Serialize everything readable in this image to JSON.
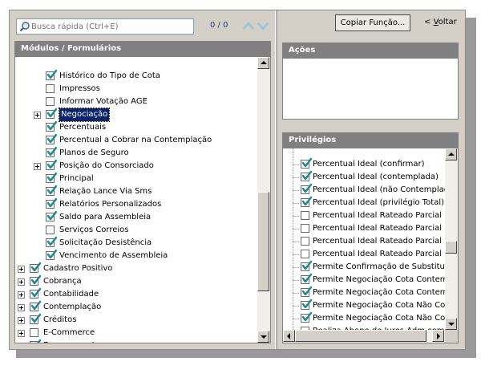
{
  "search": {
    "placeholder": "Busca rápida (Ctrl+E)",
    "count": "0 / 0"
  },
  "toolbar": {
    "copy_label": "Copiar Função...",
    "back_prefix": "< ",
    "back_underlined": "V",
    "back_rest": "oltar"
  },
  "modules": {
    "header": "Módulos / Formulários",
    "items": [
      {
        "label": "Histórico do Tipo de Cota",
        "checked": true,
        "expandable": false,
        "level": 1
      },
      {
        "label": "Impressos",
        "checked": false,
        "expandable": false,
        "level": 1
      },
      {
        "label": "Informar Votação AGE",
        "checked": false,
        "expandable": false,
        "level": 1
      },
      {
        "label": "Negociação",
        "checked": true,
        "expandable": true,
        "level": 1,
        "selected": true
      },
      {
        "label": "Percentuais",
        "checked": true,
        "expandable": false,
        "level": 1
      },
      {
        "label": "Percentual a Cobrar na Contemplação",
        "checked": true,
        "expandable": false,
        "level": 1
      },
      {
        "label": "Planos de Seguro",
        "checked": true,
        "expandable": false,
        "level": 1
      },
      {
        "label": "Posição do Consorciado",
        "checked": true,
        "expandable": true,
        "level": 1
      },
      {
        "label": "Principal",
        "checked": true,
        "expandable": false,
        "level": 1
      },
      {
        "label": "Relação Lance Via Sms",
        "checked": true,
        "expandable": false,
        "level": 1
      },
      {
        "label": "Relatórios Personalizados",
        "checked": true,
        "expandable": false,
        "level": 1
      },
      {
        "label": "Saldo para Assembleia",
        "checked": true,
        "expandable": false,
        "level": 1
      },
      {
        "label": "Serviços Correios",
        "checked": false,
        "expandable": false,
        "level": 1
      },
      {
        "label": "Solicitação Desistência",
        "checked": true,
        "expandable": false,
        "level": 1
      },
      {
        "label": "Vencimento de Assembleia",
        "checked": true,
        "expandable": false,
        "level": 1
      },
      {
        "label": "Cadastro Positivo",
        "checked": true,
        "expandable": true,
        "level": 0
      },
      {
        "label": "Cobrança",
        "checked": true,
        "expandable": true,
        "level": 0
      },
      {
        "label": "Contabilidade",
        "checked": true,
        "expandable": true,
        "level": 0
      },
      {
        "label": "Contemplação",
        "checked": true,
        "expandable": true,
        "level": 0
      },
      {
        "label": "Créditos",
        "checked": true,
        "expandable": true,
        "level": 0
      },
      {
        "label": "E-Commerce",
        "checked": false,
        "expandable": true,
        "level": 0
      },
      {
        "label": "Encerramento",
        "checked": true,
        "expandable": true,
        "level": 0
      }
    ]
  },
  "actions": {
    "header": "Ações"
  },
  "privileges": {
    "header": "Privilégios",
    "items": [
      {
        "label": "Percentual Ideal (confirmar)",
        "checked": true
      },
      {
        "label": "Percentual Ideal (contemplada)",
        "checked": true
      },
      {
        "label": "Percentual Ideal (não Contemplada)",
        "checked": true
      },
      {
        "label": "Percentual Ideal (privilégio Total)",
        "checked": true
      },
      {
        "label": "Percentual Ideal Rateado Parcial (confirmar)",
        "checked": false
      },
      {
        "label": "Percentual Ideal Rateado Parcial (contemplada)",
        "checked": false
      },
      {
        "label": "Percentual Ideal Rateado Parcial (não Contemplada)",
        "checked": false
      },
      {
        "label": "Percentual Ideal Rateado Parcial (privilégio Total)",
        "checked": false
      },
      {
        "label": "Permite Confirmação de Substituição",
        "checked": true
      },
      {
        "label": "Permite Negociação Cota Contemplada",
        "checked": true
      },
      {
        "label": "Permite Negociação Cota Contemplada Quitada",
        "checked": true
      },
      {
        "label": "Permite Negociação Cota Não Contemplada",
        "checked": true
      },
      {
        "label": "Permite Negociação Cota Não Contemplada Quitada",
        "checked": true
      },
      {
        "label": "Realiza Abono de Juros Adm comercial",
        "checked": false
      }
    ]
  }
}
